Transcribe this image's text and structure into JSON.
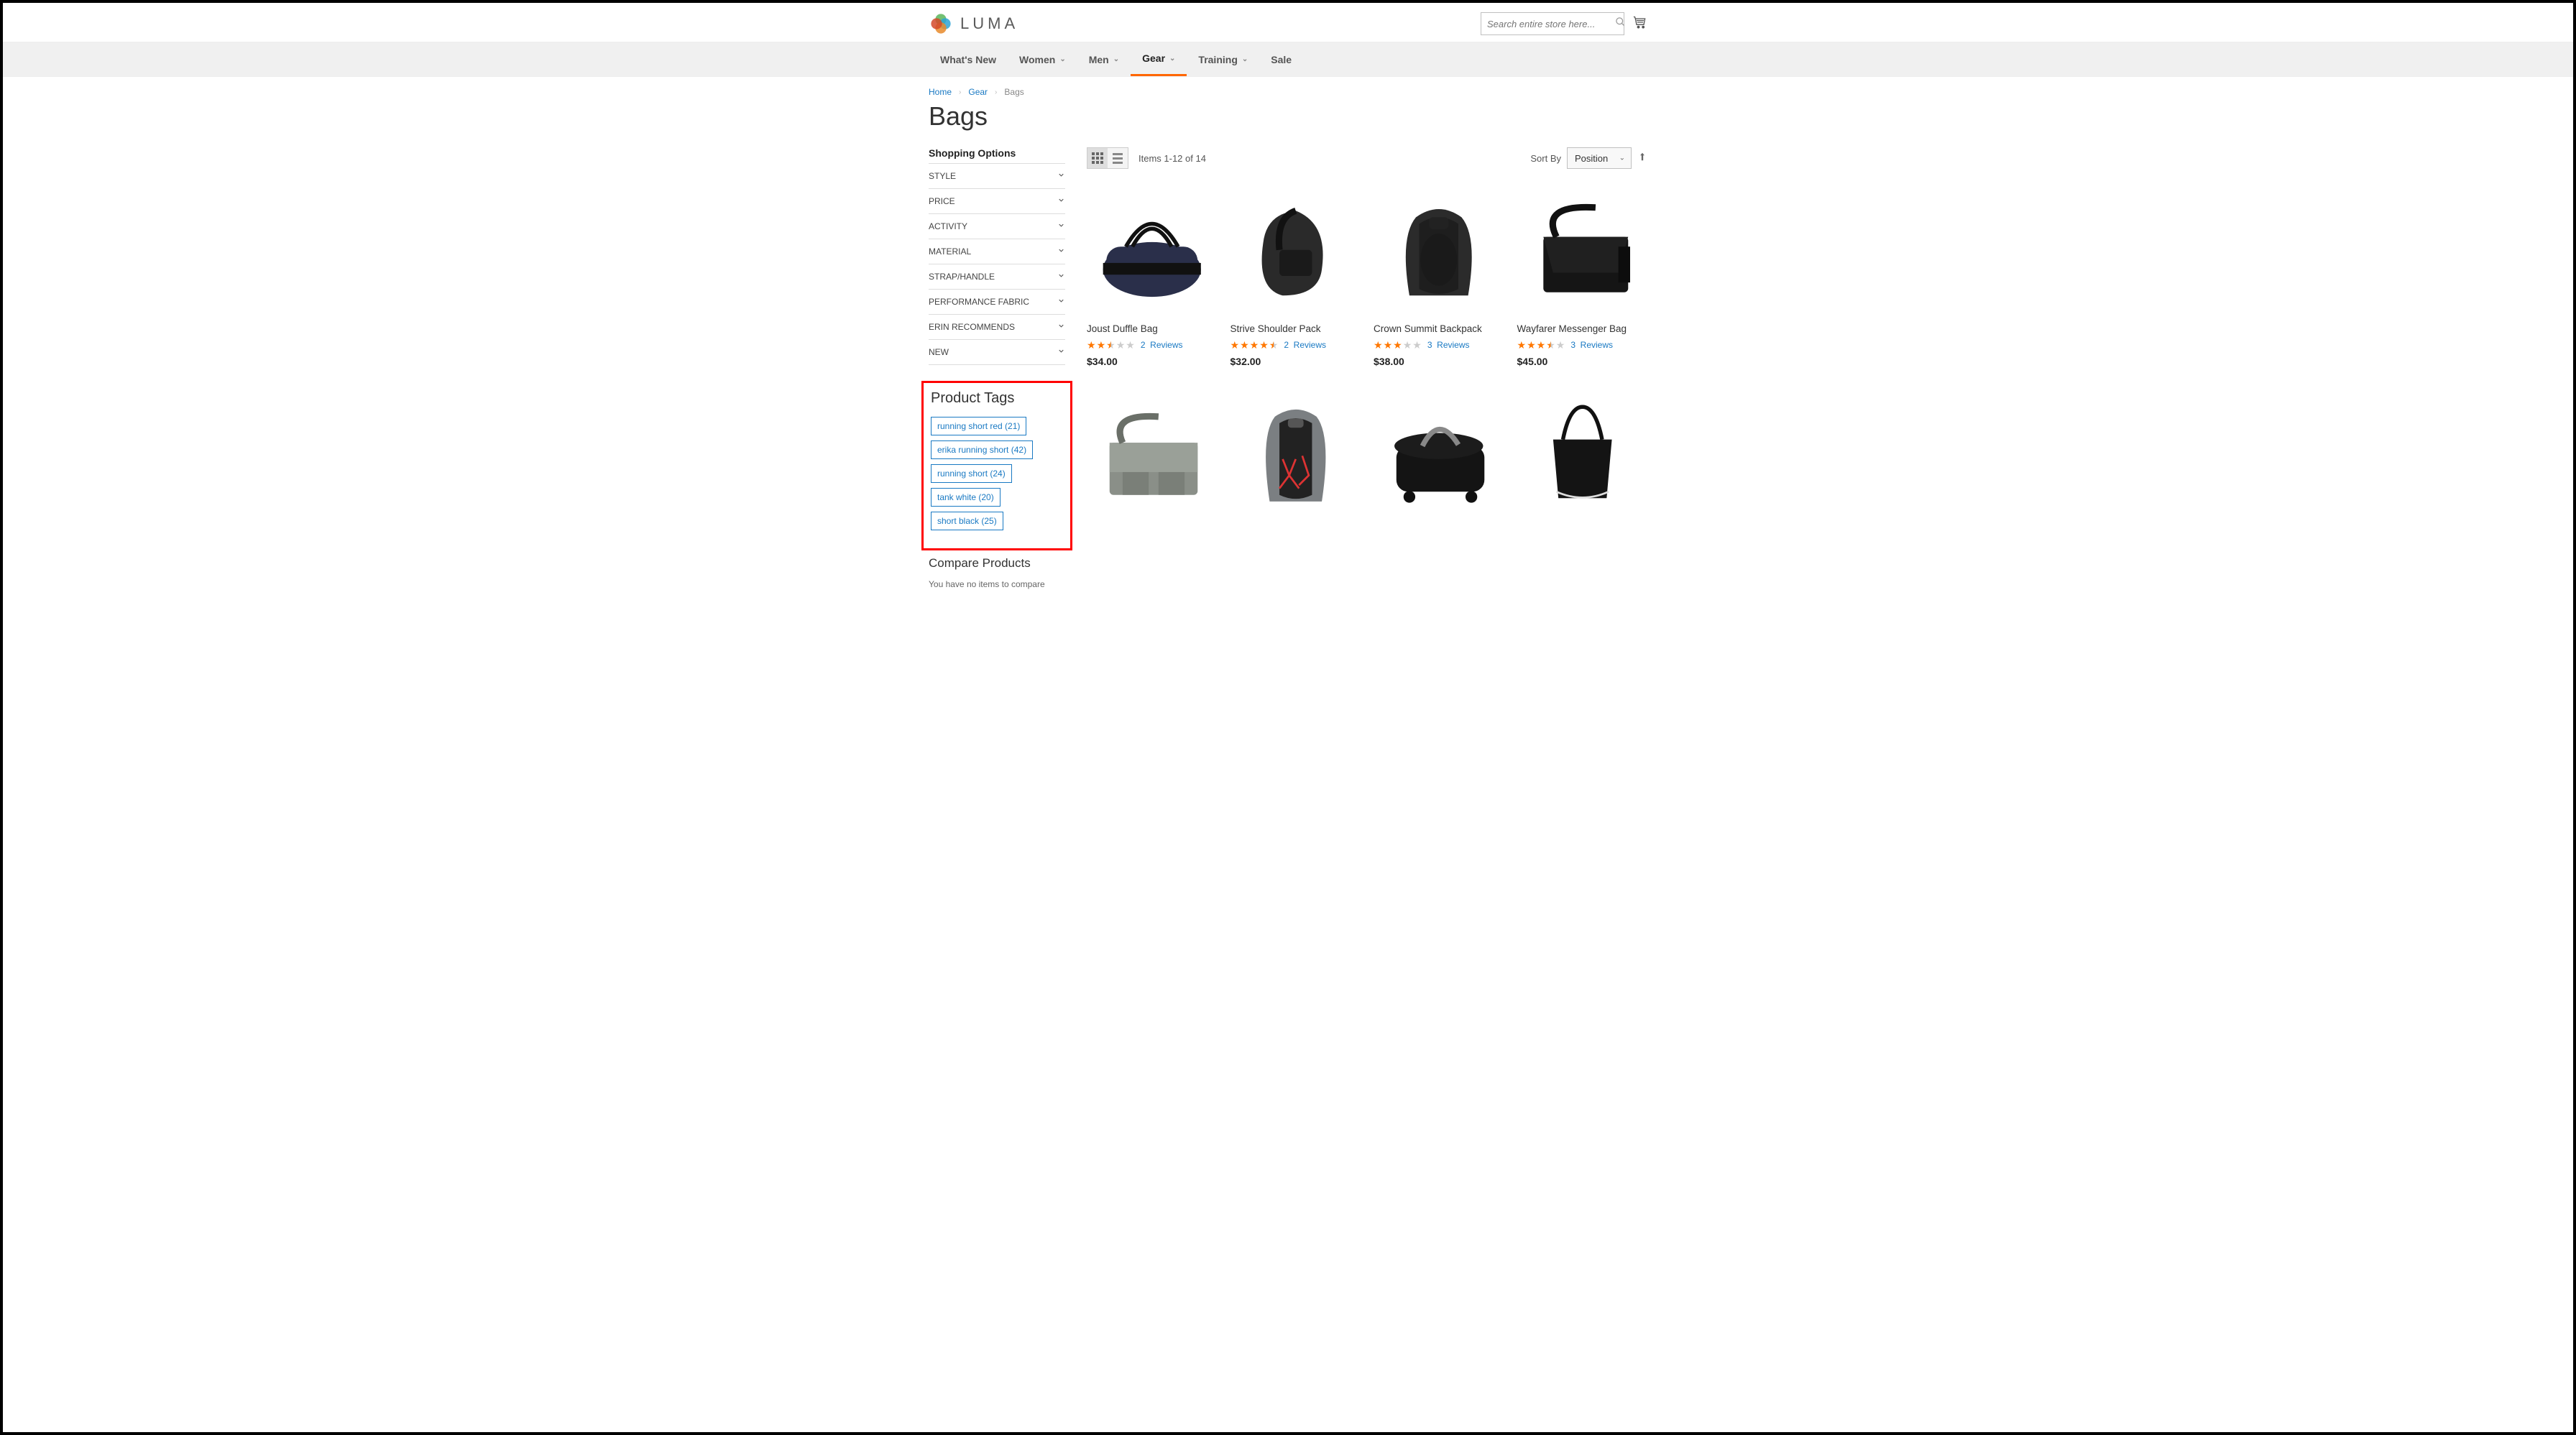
{
  "header": {
    "logo_text": "LUMA",
    "search_placeholder": "Search entire store here..."
  },
  "nav": [
    {
      "label": "What's New",
      "dropdown": false,
      "active": false
    },
    {
      "label": "Women",
      "dropdown": true,
      "active": false
    },
    {
      "label": "Men",
      "dropdown": true,
      "active": false
    },
    {
      "label": "Gear",
      "dropdown": true,
      "active": true
    },
    {
      "label": "Training",
      "dropdown": true,
      "active": false
    },
    {
      "label": "Sale",
      "dropdown": false,
      "active": false
    }
  ],
  "breadcrumb": [
    {
      "label": "Home",
      "link": true
    },
    {
      "label": "Gear",
      "link": true
    },
    {
      "label": "Bags",
      "link": false
    }
  ],
  "page_title": "Bags",
  "sidebar": {
    "shopping_options_title": "Shopping Options",
    "filters": [
      "STYLE",
      "PRICE",
      "ACTIVITY",
      "MATERIAL",
      "STRAP/HANDLE",
      "PERFORMANCE FABRIC",
      "ERIN RECOMMENDS",
      "NEW"
    ],
    "product_tags_title": "Product Tags",
    "tags": [
      "running short red (21)",
      "erika running short (42)",
      "running short (24)",
      "tank white (20)",
      "short black (25)"
    ],
    "compare_title": "Compare Products",
    "compare_note": "You have no items to compare"
  },
  "toolbar": {
    "count_text": "Items 1-12 of 14",
    "sortby_label": "Sort By",
    "sort_value": "Position"
  },
  "products": [
    {
      "name": "Joust Duffle Bag",
      "price": "$34.00",
      "reviews": "2",
      "reviews_label": "Reviews",
      "rating": 2.5
    },
    {
      "name": "Strive Shoulder Pack",
      "price": "$32.00",
      "reviews": "2",
      "reviews_label": "Reviews",
      "rating": 4.5
    },
    {
      "name": "Crown Summit Backpack",
      "price": "$38.00",
      "reviews": "3",
      "reviews_label": "Reviews",
      "rating": 3.0
    },
    {
      "name": "Wayfarer Messenger Bag",
      "price": "$45.00",
      "reviews": "3",
      "reviews_label": "Reviews",
      "rating": 3.5
    },
    {
      "name": "",
      "price": "",
      "reviews": "",
      "reviews_label": "",
      "rating": 0
    },
    {
      "name": "",
      "price": "",
      "reviews": "",
      "reviews_label": "",
      "rating": 0
    },
    {
      "name": "",
      "price": "",
      "reviews": "",
      "reviews_label": "",
      "rating": 0
    },
    {
      "name": "",
      "price": "",
      "reviews": "",
      "reviews_label": "",
      "rating": 0
    }
  ]
}
